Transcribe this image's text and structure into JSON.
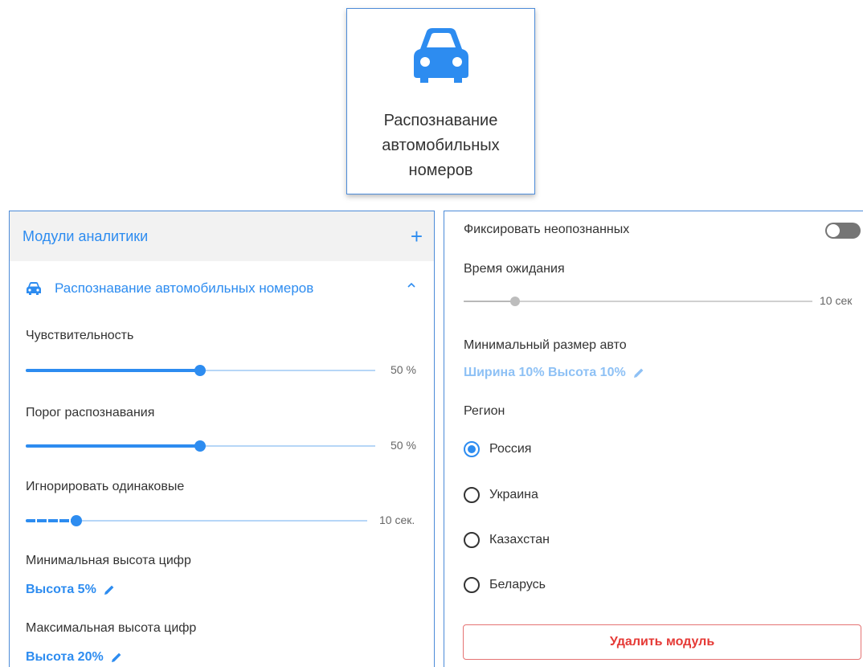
{
  "module_card": {
    "icon": "car-icon",
    "label": "Распознавание автомобильных номеров"
  },
  "left_panel": {
    "title": "Модули аналитики",
    "add_icon": "plus-icon",
    "module": {
      "icon": "car-icon",
      "name": "Распознавание автомобильных номеров",
      "expand_icon": "chevron-up-icon"
    },
    "sensitivity": {
      "label": "Чувствительность",
      "value_text": "50 %",
      "percent": 50
    },
    "threshold": {
      "label": "Порог распознавания",
      "value_text": "50 %",
      "percent": 50
    },
    "ignore_same": {
      "label": "Игнорировать одинаковые",
      "value_text": "10 сек."
    },
    "min_digit_height": {
      "label": "Минимальная высота цифр",
      "value": "Высота 5%"
    },
    "max_digit_height": {
      "label": "Максимальная высота цифр",
      "value": "Высота 20%"
    }
  },
  "right_panel": {
    "fix_unrecognized": {
      "label": "Фиксировать неопознанных",
      "enabled": false
    },
    "wait_time": {
      "label": "Время ожидания",
      "value_text": "10 сек"
    },
    "min_car_size": {
      "label": "Минимальный размер авто",
      "value": "Ширина 10% Высота 10%"
    },
    "region": {
      "label": "Регион",
      "options": [
        "Россия",
        "Украина",
        "Казахстан",
        "Беларусь"
      ],
      "selected": "Россия"
    },
    "delete_label": "Удалить модуль"
  },
  "colors": {
    "accent": "#2d8cf0",
    "danger": "#e53935",
    "border": "#4c8bd8"
  }
}
